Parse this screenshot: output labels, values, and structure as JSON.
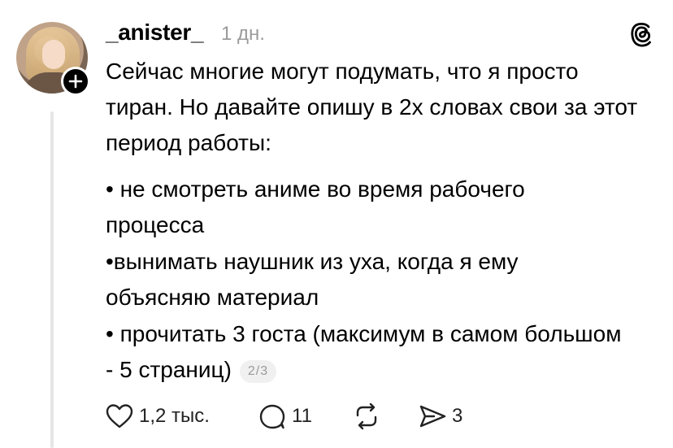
{
  "post": {
    "username": "_anister_",
    "time": "1 дн.",
    "paragraphs": [
      "Сейчас многие могут подумать, что я просто тиран. Но давайте опишу в 2х словах свои за этот период работы:",
      "• не смотреть аниме во время рабочего процесса",
      "•вынимать наушник из уха, когда я ему объясняю материал",
      "• прочитать 3 госта (максимум в самом большом - 5 страниц)"
    ],
    "pager": "2/3"
  },
  "actions": {
    "likes": "1,2 тыс.",
    "comments": "11",
    "shares": "3"
  },
  "icons": {
    "like": "heart-icon",
    "comment": "comment-bubble-icon",
    "repost": "repost-icon",
    "share": "send-icon",
    "logo": "threads-logo-icon",
    "follow": "plus-icon"
  }
}
